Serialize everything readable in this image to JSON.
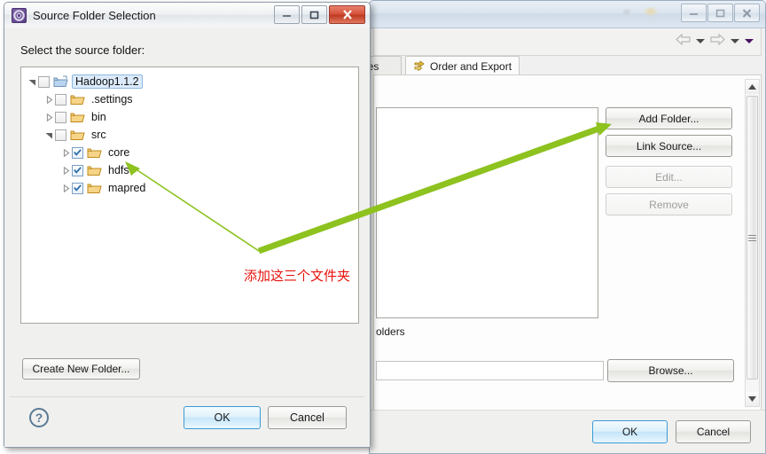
{
  "background_window": {
    "titlebar": {
      "title": "",
      "buttons": [
        {
          "name": "minimize",
          "glyph": "minimize-icon"
        },
        {
          "name": "maximize",
          "glyph": "maximize-icon"
        },
        {
          "name": "close",
          "glyph": "close-icon"
        }
      ]
    },
    "toolbar": {
      "nav_back": "back-arrow-icon",
      "nav_back_menu": "chevron-down-icon",
      "nav_forward": "forward-arrow-icon",
      "nav_forward_menu": "chevron-down-icon",
      "overflow_menu": "chevron-down-purple-icon"
    },
    "tabs": [
      {
        "label": "ies",
        "icon": "",
        "active": false
      },
      {
        "label": "Order and Export",
        "icon": "order-export-icon",
        "active": true
      }
    ],
    "side_buttons": [
      {
        "label": "Add Folder...",
        "enabled": true
      },
      {
        "label": "Link Source...",
        "enabled": true
      },
      {
        "label": "Edit...",
        "enabled": false
      },
      {
        "label": "Remove",
        "enabled": false
      }
    ],
    "folders_label": "olders",
    "path_input": {
      "value": "",
      "placeholder": ""
    },
    "browse_label": "Browse...",
    "scrollbar": {
      "up": "scroll-up-icon",
      "down": "scroll-down-icon",
      "grip": "scrollbar-grip"
    },
    "footer": {
      "ok_label": "OK",
      "cancel_label": "Cancel"
    }
  },
  "dialog": {
    "title": "Source Folder Selection",
    "icon": "eclipse-gear-icon",
    "window_buttons": [
      {
        "name": "minimize",
        "glyph": "minimize-icon"
      },
      {
        "name": "maximize",
        "glyph": "maximize-icon"
      },
      {
        "name": "close",
        "glyph": "close-icon"
      }
    ],
    "prompt": "Select the source folder:",
    "tree": [
      {
        "label": "Hadoop1.1.2",
        "indent": 0,
        "expander": "expanded",
        "checked": false,
        "selected": true,
        "folder": "folder-open-blue-icon"
      },
      {
        "label": ".settings",
        "indent": 1,
        "expander": "collapsed",
        "checked": false,
        "selected": false,
        "folder": "folder-icon"
      },
      {
        "label": "bin",
        "indent": 1,
        "expander": "collapsed",
        "checked": false,
        "selected": false,
        "folder": "folder-icon"
      },
      {
        "label": "src",
        "indent": 1,
        "expander": "expanded",
        "checked": false,
        "selected": false,
        "folder": "folder-icon"
      },
      {
        "label": "core",
        "indent": 2,
        "expander": "collapsed",
        "checked": true,
        "selected": false,
        "folder": "folder-icon"
      },
      {
        "label": "hdfs",
        "indent": 2,
        "expander": "collapsed",
        "checked": true,
        "selected": false,
        "folder": "folder-icon"
      },
      {
        "label": "mapred",
        "indent": 2,
        "expander": "collapsed",
        "checked": true,
        "selected": false,
        "folder": "folder-icon"
      }
    ],
    "create_folder_label": "Create New Folder...",
    "help_glyph": "?",
    "ok_label": "OK",
    "cancel_label": "Cancel"
  },
  "annotation": {
    "text": "添加这三个文件夹",
    "color": "#e8120c",
    "arrow_color": "#8dc21f"
  }
}
